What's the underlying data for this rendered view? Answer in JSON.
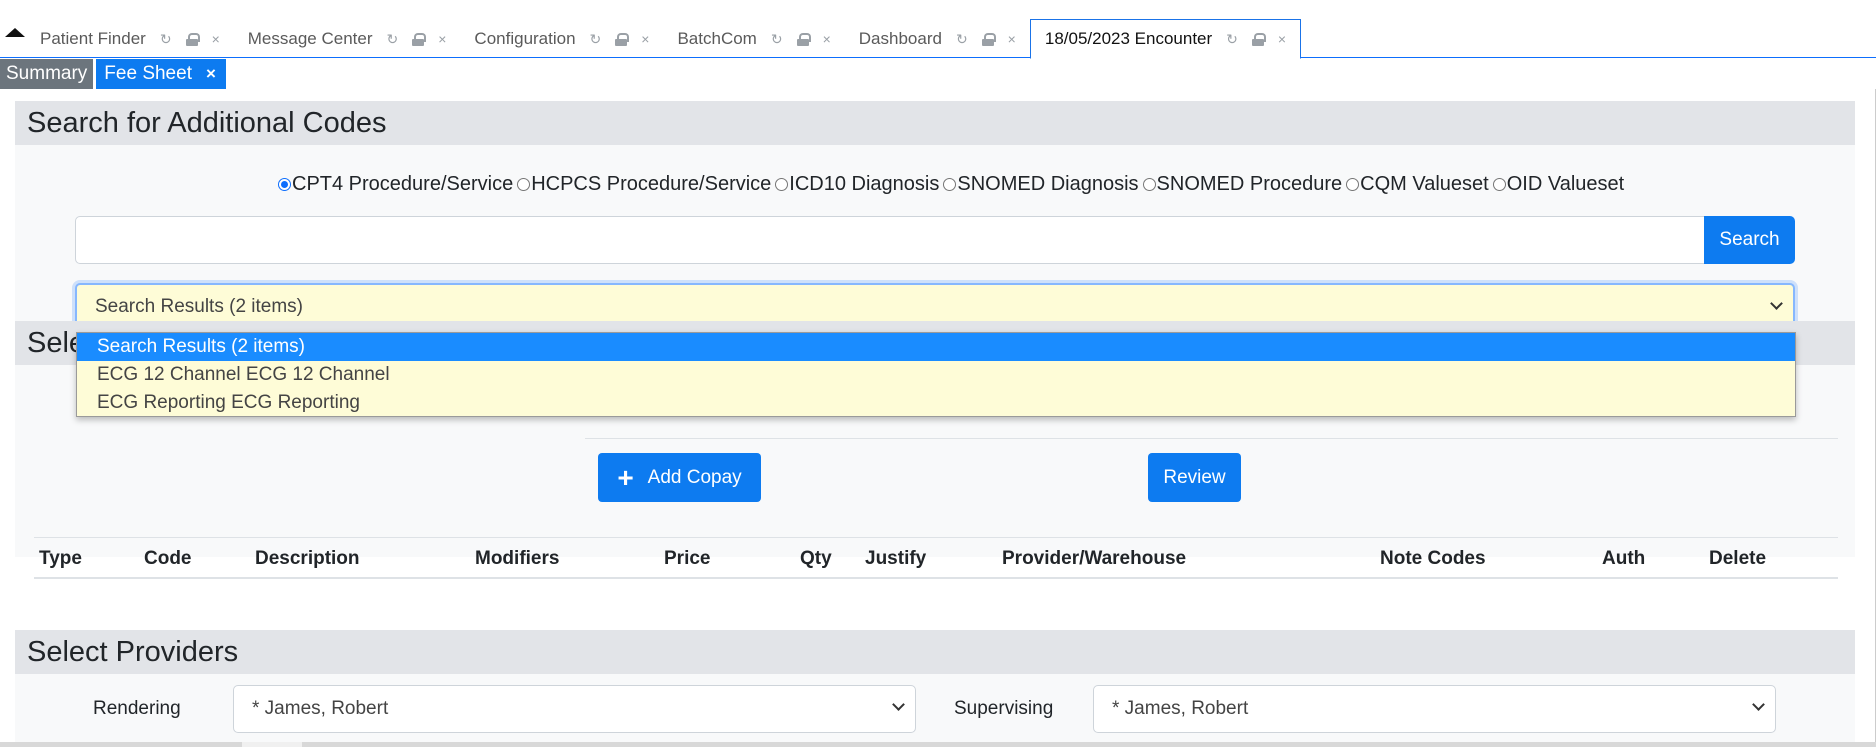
{
  "tabs": [
    {
      "label": "Patient Finder"
    },
    {
      "label": "Message Center"
    },
    {
      "label": "Configuration"
    },
    {
      "label": "BatchCom"
    },
    {
      "label": "Dashboard"
    },
    {
      "label": "18/05/2023 Encounter",
      "active": true
    }
  ],
  "tab_icons": {
    "refresh": "↻",
    "close": "×"
  },
  "subtabs": {
    "summary": "Summary",
    "fee_sheet": "Fee Sheet",
    "close": "×"
  },
  "search_section": {
    "title": "Search for Additional Codes",
    "code_types": [
      {
        "label": "CPT4 Procedure/Service",
        "checked": true
      },
      {
        "label": "HCPCS Procedure/Service",
        "checked": false
      },
      {
        "label": "ICD10 Diagnosis",
        "checked": false
      },
      {
        "label": "SNOMED Diagnosis",
        "checked": false
      },
      {
        "label": "SNOMED Procedure",
        "checked": false
      },
      {
        "label": "CQM Valueset",
        "checked": false
      },
      {
        "label": "OID Valueset",
        "checked": false
      }
    ],
    "search_value": "",
    "search_button": "Search",
    "results_selected": "Search Results (2 items)",
    "results_options": [
      "Search Results (2 items)",
      "ECG 12 Channel ECG 12 Channel",
      "ECG Reporting ECG Reporting"
    ]
  },
  "codes_section": {
    "title_visible": "Sele",
    "add_copay_label": "Add Copay",
    "review_label": "Review",
    "columns": [
      "Type",
      "Code",
      "Description",
      "Modifiers",
      "Price",
      "Qty",
      "Justify",
      "Provider/Warehouse",
      "Note Codes",
      "Auth",
      "Delete"
    ]
  },
  "providers_section": {
    "title": "Select Providers",
    "rendering_label": "Rendering",
    "rendering_value": "* James, Robert",
    "supervising_label": "Supervising",
    "supervising_value": "* James, Robert"
  },
  "colors": {
    "primary": "#0d7bf0",
    "select_bg": "#fefcd7",
    "header_bg": "#e2e4e8"
  }
}
